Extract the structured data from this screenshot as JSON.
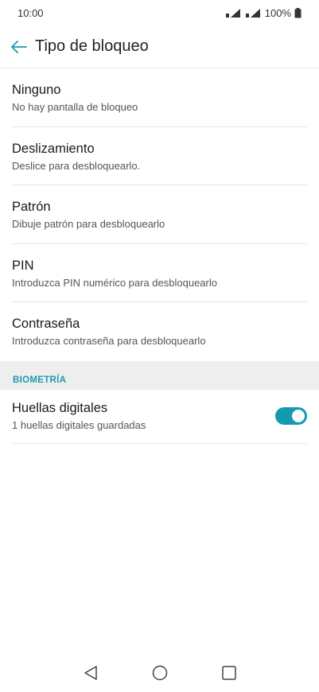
{
  "status_bar": {
    "time": "10:00",
    "battery": "100%"
  },
  "app_bar": {
    "title": "Tipo de bloqueo"
  },
  "items": [
    {
      "title": "Ninguno",
      "subtitle": "No hay pantalla de bloqueo"
    },
    {
      "title": "Deslizamiento",
      "subtitle": "Deslice para desbloquearlo."
    },
    {
      "title": "Patrón",
      "subtitle": "Dibuje patrón para desbloquearlo"
    },
    {
      "title": "PIN",
      "subtitle": "Introduzca PIN numérico para desbloquearlo"
    },
    {
      "title": "Contraseña",
      "subtitle": "Introduzca contraseña para desbloquearlo"
    }
  ],
  "biometrics": {
    "header": "BIOMETRÍA",
    "fingerprint": {
      "title": "Huellas digitales",
      "subtitle": "1 huellas digitales guardadas",
      "enabled": true
    }
  },
  "colors": {
    "accent": "#149aac",
    "section_text": "#1c9bb0"
  }
}
